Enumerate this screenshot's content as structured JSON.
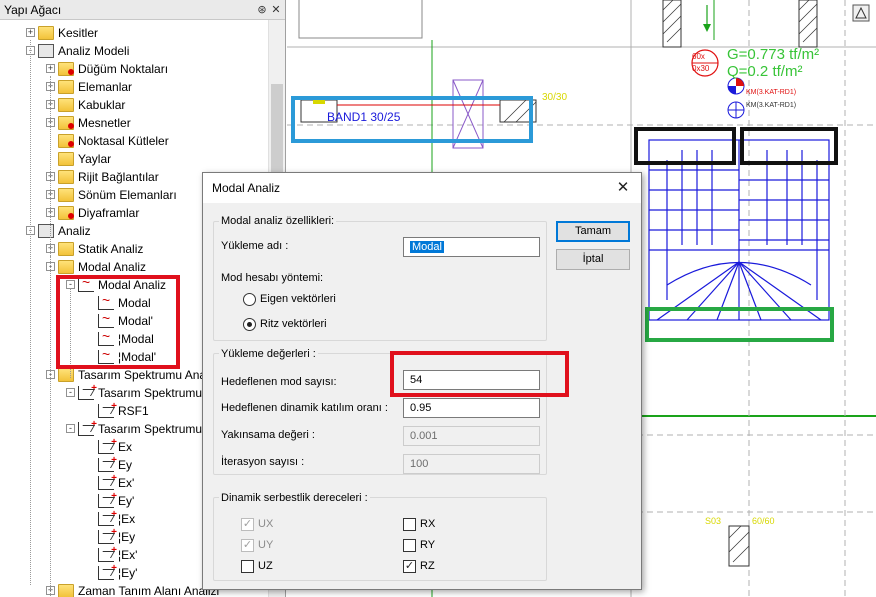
{
  "tree": {
    "title": "Yapı Ağacı",
    "pin_icon": "pin-icon",
    "close_icon": "close-icon",
    "rows": [
      {
        "label": "Kesitler",
        "expander": "+",
        "icon": "folder"
      },
      {
        "label": "Analiz Modeli",
        "expander": "-",
        "icon": "model"
      },
      {
        "label": "Düğüm Noktaları",
        "expander": "+",
        "icon": "folder-red"
      },
      {
        "label": "Elemanlar",
        "expander": "+",
        "icon": "folder"
      },
      {
        "label": "Kabuklar",
        "expander": "+",
        "icon": "folder"
      },
      {
        "label": "Mesnetler",
        "expander": "+",
        "icon": "folder-red"
      },
      {
        "label": "Noktasal Kütleler",
        "expander": "",
        "icon": "folder-red"
      },
      {
        "label": "Yaylar",
        "expander": "",
        "icon": "folder"
      },
      {
        "label": "Rijit Bağlantılar",
        "expander": "+",
        "icon": "folder"
      },
      {
        "label": "Sönüm Elemanları",
        "expander": "+",
        "icon": "folder"
      },
      {
        "label": "Diyaframlar",
        "expander": "+",
        "icon": "folder-red"
      },
      {
        "label": "Analiz",
        "expander": "-",
        "icon": "model"
      },
      {
        "label": "Statik Analiz",
        "expander": "+",
        "icon": "folder"
      },
      {
        "label": "Modal Analiz",
        "expander": "-",
        "icon": "folder"
      },
      {
        "label": "Modal Analiz",
        "expander": "-",
        "icon": "modal"
      },
      {
        "label": "Modal",
        "expander": "",
        "icon": "modal"
      },
      {
        "label": "Modal'",
        "expander": "",
        "icon": "modal"
      },
      {
        "label": "¦Modal",
        "expander": "",
        "icon": "modal"
      },
      {
        "label": "¦Modal'",
        "expander": "",
        "icon": "modal"
      },
      {
        "label": "Tasarım Spektrumu Analizi",
        "expander": "-",
        "icon": "folder"
      },
      {
        "label": "Tasarım Spektrumu",
        "expander": "-",
        "icon": "spec"
      },
      {
        "label": "RSF1",
        "expander": "",
        "icon": "spec"
      },
      {
        "label": "Tasarım Spektrumu",
        "expander": "-",
        "icon": "spec"
      },
      {
        "label": "Ex",
        "expander": "",
        "icon": "spec"
      },
      {
        "label": "Ey",
        "expander": "",
        "icon": "spec"
      },
      {
        "label": "Ex'",
        "expander": "",
        "icon": "spec"
      },
      {
        "label": "Ey'",
        "expander": "",
        "icon": "spec"
      },
      {
        "label": "¦Ex",
        "expander": "",
        "icon": "spec"
      },
      {
        "label": "¦Ey",
        "expander": "",
        "icon": "spec"
      },
      {
        "label": "¦Ex'",
        "expander": "",
        "icon": "spec"
      },
      {
        "label": "¦Ey'",
        "expander": "",
        "icon": "spec"
      },
      {
        "label": "Zaman Tanım Alanı Analizi",
        "expander": "+",
        "icon": "folder"
      }
    ]
  },
  "drawing": {
    "band_label": "BAND1 30/25",
    "dim_label_a": "30/30",
    "load_g": "G=0.773 tf/m²",
    "load_q": "Q=0.2 tf/m²",
    "story_label_1": "KM(3.KAT-RD1)",
    "story_label_2": "KM(3.KAT-RD1)",
    "dim_label_b": "S03",
    "dim_label_c": "60/60",
    "beam_tag_1": "60x",
    "beam_tag_2": "0x30",
    "colors": {
      "beam_blue": "#1a1adb",
      "grid_green": "#1aa31a",
      "label_yellow": "#d8d800",
      "load_green": "#38c438",
      "axis_red": "#e01010"
    }
  },
  "dialog": {
    "title": "Modal Analiz",
    "ok_label": "Tamam",
    "cancel_label": "İptal",
    "group1_title": "Modal analiz özellikleri:",
    "load_name_label": "Yükleme adı :",
    "load_name_value": "Modal",
    "method_label": "Mod hesabı yöntemi:",
    "method_options": [
      {
        "label": "Eigen vektörleri",
        "selected": false
      },
      {
        "label": "Ritz vektörleri",
        "selected": true
      }
    ],
    "group2_title": "Yükleme değerleri :",
    "mode_count_label": "Hedeflenen mod sayısı:",
    "mode_count_value": "54",
    "participation_label": "Hedeflenen dinamik katılım oranı :",
    "participation_value": "0.95",
    "convergence_label": "Yakınsama değeri :",
    "convergence_value": "0.001",
    "iteration_label": "İterasyon sayısı :",
    "iteration_value": "100",
    "group3_title": "Dinamik serbestlik dereceleri :",
    "dofs": [
      {
        "label": "UX",
        "checked": true,
        "enabled": false
      },
      {
        "label": "RX",
        "checked": false,
        "enabled": true
      },
      {
        "label": "UY",
        "checked": true,
        "enabled": false
      },
      {
        "label": "RY",
        "checked": false,
        "enabled": true
      },
      {
        "label": "UZ",
        "checked": false,
        "enabled": true
      },
      {
        "label": "RZ",
        "checked": true,
        "enabled": true
      }
    ]
  }
}
